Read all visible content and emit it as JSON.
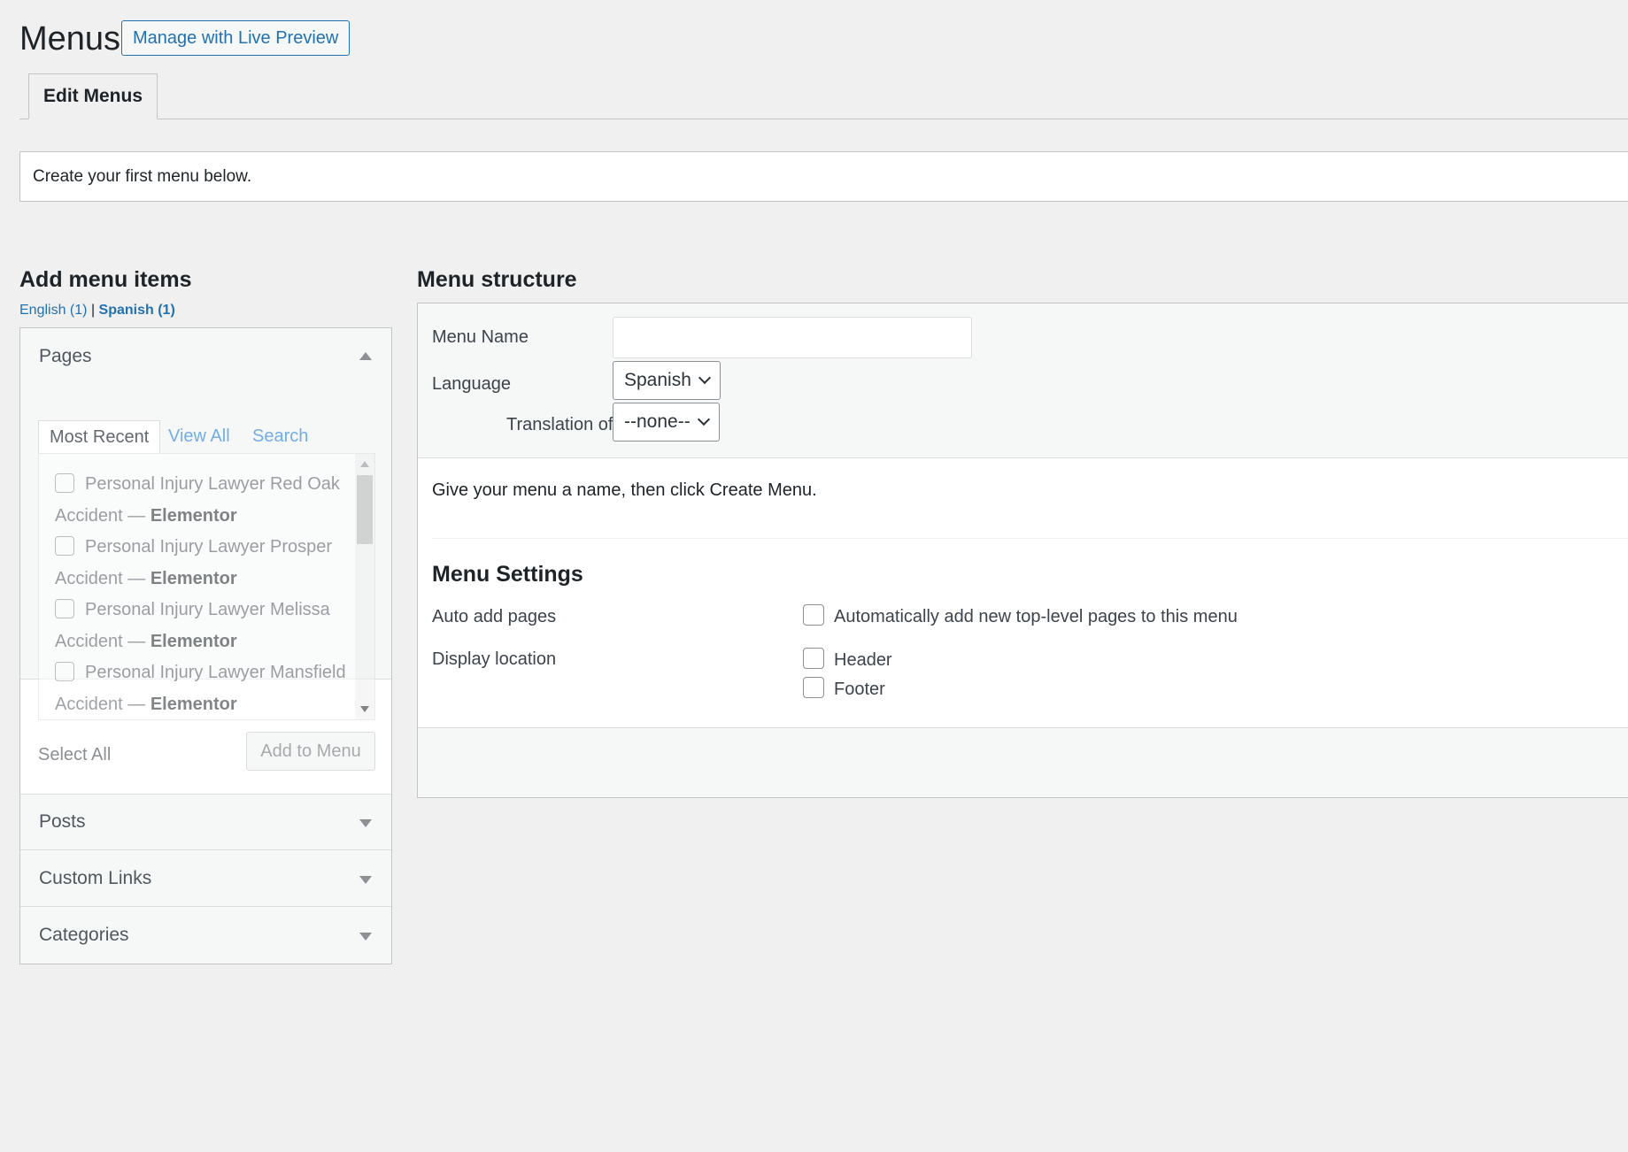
{
  "header": {
    "title": "Menus",
    "live_preview_label": "Manage with Live Preview"
  },
  "tabs": [
    {
      "label": "Edit Menus",
      "active": true
    }
  ],
  "notice": "Create your first menu below.",
  "left": {
    "heading": "Add menu items",
    "languages": {
      "english": "English (1)",
      "separator": "|",
      "spanish": "Spanish (1)"
    },
    "sections": {
      "pages": {
        "title": "Pages",
        "tabs": [
          "Most Recent",
          "View All",
          "Search"
        ],
        "items": [
          {
            "name": "Personal Injury Lawyer Red Oak",
            "suffix": "Accident —",
            "title": "Elementor"
          },
          {
            "name": "Personal Injury Lawyer Prosper",
            "suffix": "Accident —",
            "title": "Elementor"
          },
          {
            "name": "Personal Injury Lawyer Melissa",
            "suffix": "Accident —",
            "title": "Elementor"
          },
          {
            "name": "Personal Injury Lawyer Mansfield",
            "suffix": "Accident —",
            "title": "Elementor"
          }
        ],
        "select_all": "Select All",
        "add_button": "Add to Menu"
      },
      "posts": {
        "title": "Posts"
      },
      "custom_links": {
        "title": "Custom Links"
      },
      "categories": {
        "title": "Categories"
      }
    }
  },
  "right": {
    "heading": "Menu structure",
    "menu_name_label": "Menu Name",
    "menu_name_value": "",
    "language_label": "Language",
    "language_value": "Spanish",
    "translation_label": "Translation of",
    "translation_value": "--none--",
    "instruction": "Give your menu a name, then click Create Menu.",
    "settings": {
      "title": "Menu Settings",
      "auto_add_label": "Auto add pages",
      "auto_add_option": "Automatically add new top-level pages to this menu",
      "display_location_label": "Display location",
      "locations": [
        "Header",
        "Footer"
      ]
    }
  },
  "colors": {
    "accent": "#2271b1",
    "background": "#f0f0f1",
    "border": "#c3c4c7"
  }
}
